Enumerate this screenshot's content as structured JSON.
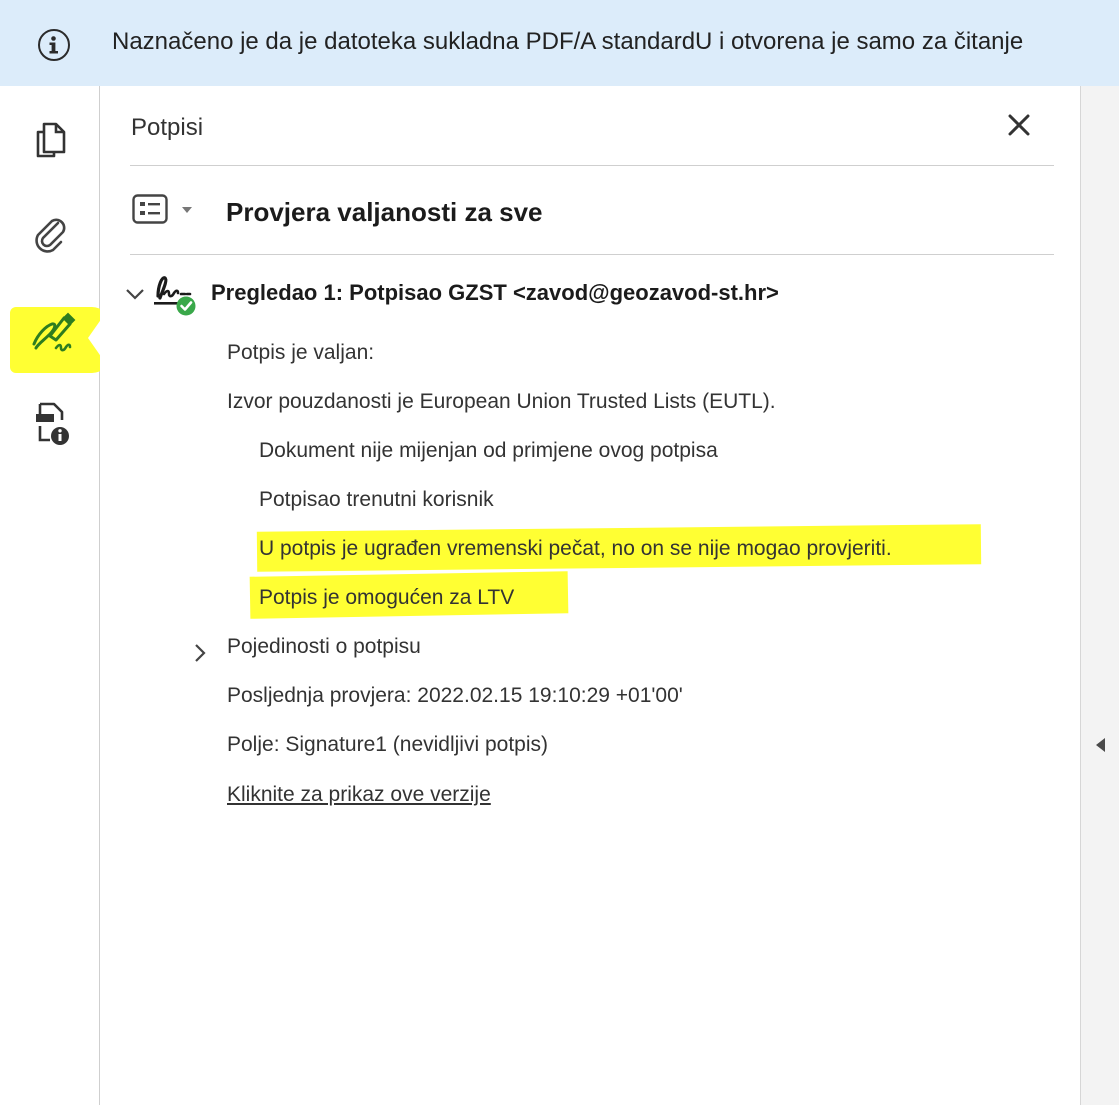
{
  "banner": {
    "icon": "info-circle-icon",
    "text": "Naznačeno je da je datoteka sukladna PDF/A standardU i otvorena je samo za čitanje"
  },
  "toolbar": {
    "items": [
      {
        "icon": "pages-icon"
      },
      {
        "icon": "attachment-paperclip-icon"
      },
      {
        "icon": "signature-pen-icon",
        "active": true
      },
      {
        "icon": "document-info-icon"
      }
    ]
  },
  "panel": {
    "title": "Potpisi",
    "close_icon": "close-x-icon",
    "validate_all_label": "Provjera valjanosti za sve",
    "signature": {
      "title": "Pregledao 1: Potpisao GZST <zavod@geozavod-st.hr>",
      "status_icon": "valid-checkmark-icon",
      "status_line": "Potpis je valjan:",
      "trust_source": "Izvor pouzdanosti je European Union Trusted Lists (EUTL).",
      "details": [
        "Dokument nije mijenjan od primjene ovog potpisa",
        "Potpisao trenutni korisnik",
        "U potpis je ugrađen vremenski pečat, no on se nije mogao provjeriti.",
        "Potpis je omogućen za LTV"
      ],
      "details_toggle_label": "Pojedinosti o potpisu",
      "last_checked": "Posljednja provjera: 2022.02.15 19:10:29 +01'00'",
      "field": "Polje: Signature1 (nevidljivi potpis)",
      "view_version_link": "Kliknite za prikaz ove verzije"
    }
  },
  "colors": {
    "banner_bg": "#dcecfa",
    "highlight": "#ffff33",
    "signature_icon_green": "#2e7d1f",
    "valid_green": "#3aa84a"
  }
}
